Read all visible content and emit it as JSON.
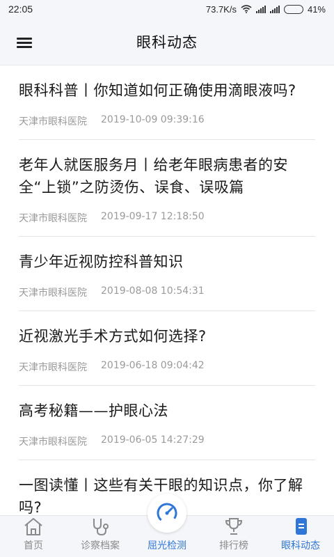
{
  "status": {
    "time": "22:05",
    "network_speed": "73.7K/s",
    "battery": "41%",
    "battery_level": 0.41
  },
  "header": {
    "title": "眼科动态",
    "menu_icon": "hamburger-menu-icon"
  },
  "articles": [
    {
      "title": "眼科科普丨你知道如何正确使用滴眼液吗?",
      "source": "天津市眼科医院",
      "date": "2019-10-09 09:39:16"
    },
    {
      "title": "老年人就医服务月丨给老年眼病患者的安全“上锁”之防烫伤、误食、误吸篇",
      "source": "天津市眼科医院",
      "date": "2019-09-17 12:18:50"
    },
    {
      "title": "青少年近视防控科普知识",
      "source": "天津市眼科医院",
      "date": "2019-08-08 10:54:31"
    },
    {
      "title": "近视激光手术方式如何选择?",
      "source": "天津市眼科医院",
      "date": "2019-06-18 09:04:42"
    },
    {
      "title": "高考秘籍——护眼心法",
      "source": "天津市眼科医院",
      "date": "2019-06-05 14:27:29"
    },
    {
      "title": "一图读懂丨这些有关干眼的知识点，你了解吗?",
      "source": "",
      "date": ""
    }
  ],
  "tabbar": {
    "accent": "#2f76d6",
    "inactive": "#8a8a8a",
    "tabs": [
      {
        "label": "首页",
        "icon": "home-icon"
      },
      {
        "label": "诊察档案",
        "icon": "stethoscope-icon"
      },
      {
        "label": "屈光检测",
        "icon": "gauge-icon"
      },
      {
        "label": "排行榜",
        "icon": "trophy-icon"
      },
      {
        "label": "眼科动态",
        "icon": "document-icon",
        "active": true
      }
    ]
  }
}
